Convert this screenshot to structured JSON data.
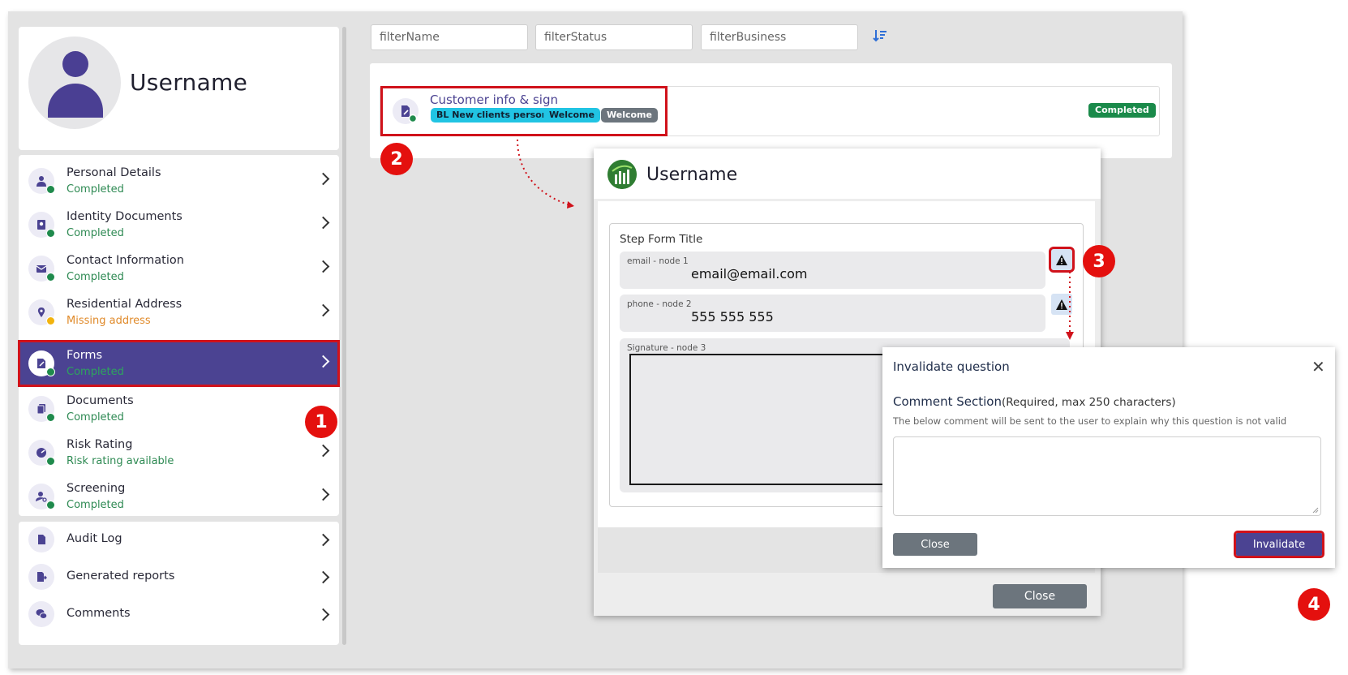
{
  "profile": {
    "username": "Username"
  },
  "sidebar": {
    "items": [
      {
        "label": "Personal Details",
        "status": "Completed",
        "icon": "person-icon",
        "dot": "green"
      },
      {
        "label": "Identity Documents",
        "status": "Completed",
        "icon": "passport-icon",
        "dot": "green"
      },
      {
        "label": "Contact Information",
        "status": "Completed",
        "icon": "envelope-icon",
        "dot": "green"
      },
      {
        "label": "Residential Address",
        "status": "Missing address",
        "icon": "map-pin-icon",
        "dot": "yellow"
      },
      {
        "label": "Forms",
        "status": "Completed",
        "icon": "form-icon",
        "dot": "green",
        "active": true
      },
      {
        "label": "Documents",
        "status": "Completed",
        "icon": "documents-icon",
        "dot": "green"
      },
      {
        "label": "Risk Rating",
        "status": "Risk rating available",
        "icon": "risk-icon",
        "dot": "green"
      },
      {
        "label": "Screening",
        "status": "Completed",
        "icon": "screening-icon",
        "dot": "green"
      }
    ],
    "tools": [
      {
        "label": "Audit Log",
        "icon": "file-icon"
      },
      {
        "label": "Generated reports",
        "icon": "report-export-icon"
      },
      {
        "label": "Comments",
        "icon": "comments-icon"
      }
    ]
  },
  "filters": {
    "name_placeholder": "filterName",
    "status_placeholder": "filterStatus",
    "business_placeholder": "filterBusiness"
  },
  "form_row": {
    "title": "Customer info & sign",
    "tags": [
      "BL New clients person",
      "Welcome",
      "Welcome"
    ],
    "status": "Completed"
  },
  "markers": [
    "1",
    "2",
    "3",
    "4"
  ],
  "modal": {
    "title": "Username",
    "step_title": "Step Form Title",
    "fields": [
      {
        "label": "email - node 1",
        "value": "email@email.com"
      },
      {
        "label": "phone - node 2",
        "value": "555 555 555"
      },
      {
        "label": "Signature - node 3",
        "value": ""
      }
    ],
    "close_label": "Close"
  },
  "dialog": {
    "title": "Invalidate question",
    "section_title": "Comment Section",
    "section_req": "(Required, max 250 characters)",
    "help": "The below comment will be sent to the user to explain why this question is not valid",
    "close_label": "Close",
    "invalidate_label": "Invalidate"
  },
  "colors": {
    "brand": "#4b4392",
    "success": "#1a8a4a",
    "warning": "#e08a2a",
    "highlight": "#d0121b",
    "marker": "#e4100e"
  }
}
